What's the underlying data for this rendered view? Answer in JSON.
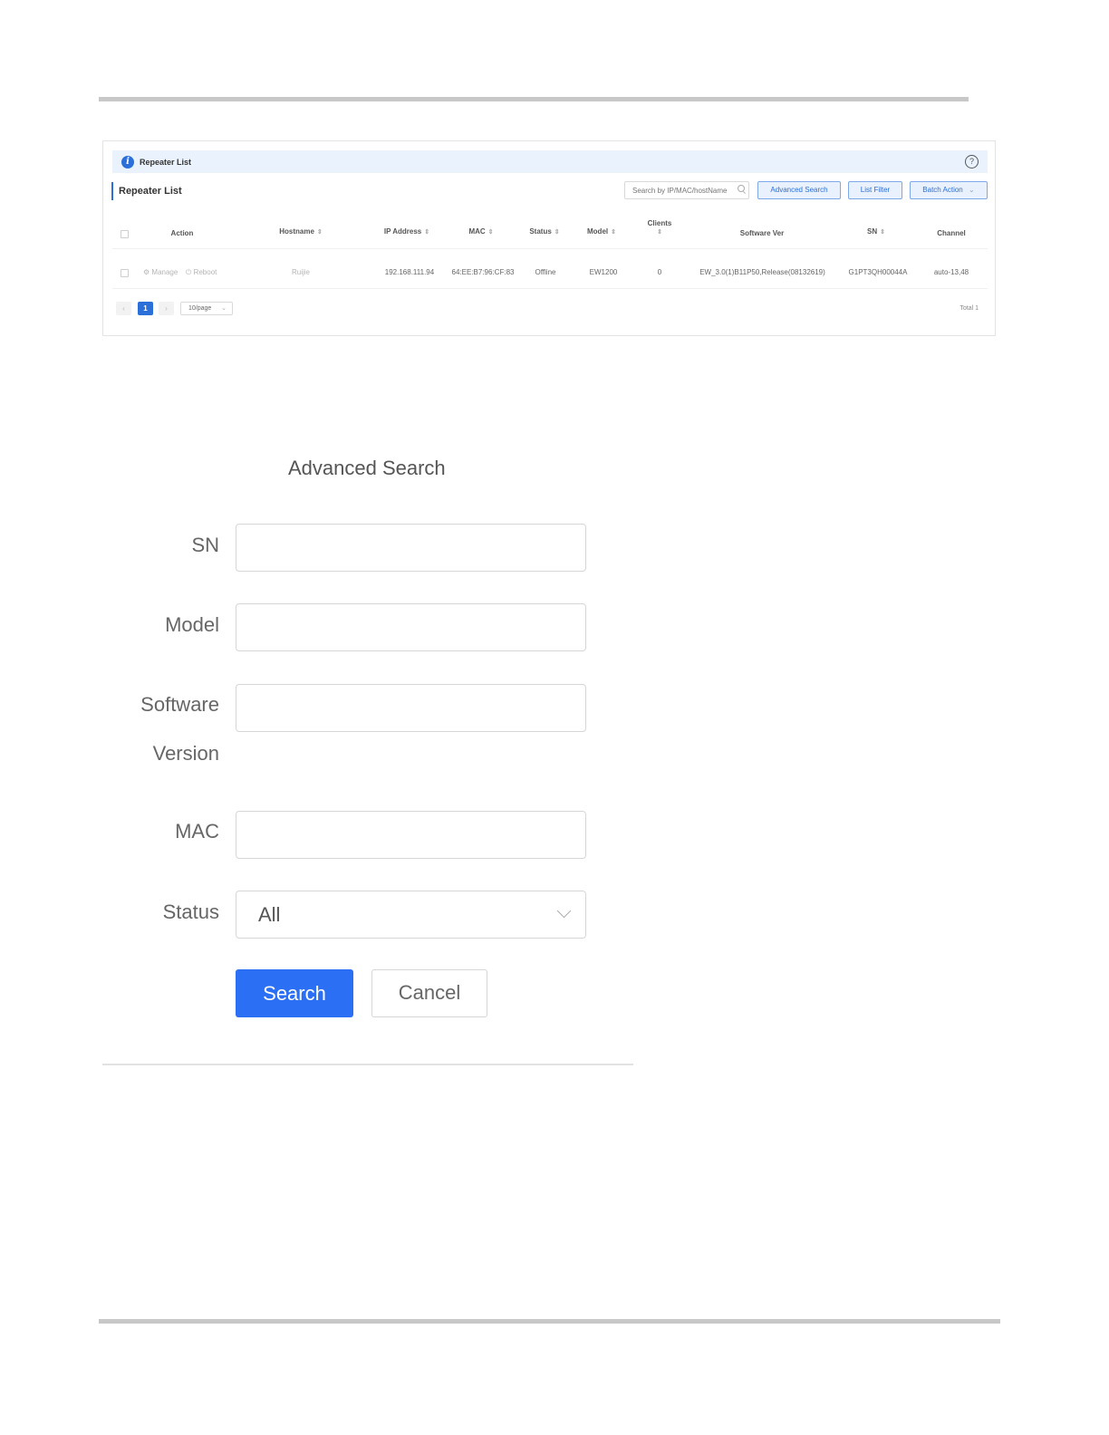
{
  "repeater_panel": {
    "info_title": "Repeater List",
    "list_title": "Repeater List",
    "search_placeholder": "Search by IP/MAC/hostName",
    "buttons": {
      "advanced_search": "Advanced Search",
      "list_filter": "List Filter",
      "batch_action": "Batch Action"
    },
    "columns": {
      "action": "Action",
      "hostname": "Hostname",
      "ip": "IP Address",
      "mac": "MAC",
      "status": "Status",
      "model": "Model",
      "clients": "Clients",
      "software": "Software Ver",
      "sn": "SN",
      "channel": "Channel"
    },
    "row": {
      "manage": "Manage",
      "reboot": "Reboot",
      "hostname": "Ruijie",
      "ip": "192.168.111.94",
      "mac": "64:EE:B7:96:CF:83",
      "status": "Offline",
      "model": "EW1200",
      "clients": "0",
      "software": "EW_3.0(1)B11P50,Release(08132619)",
      "sn": "G1PT3QH00044A",
      "channel": "auto-13,48"
    },
    "pagination": {
      "current_page": "1",
      "page_size": "10/page",
      "total": "Total 1"
    }
  },
  "advanced_search": {
    "title": "Advanced Search",
    "labels": {
      "sn": "SN",
      "model": "Model",
      "software_line1": "Software",
      "software_line2": "Version",
      "mac": "MAC",
      "status": "Status"
    },
    "status_value": "All",
    "search_button": "Search",
    "cancel_button": "Cancel"
  }
}
